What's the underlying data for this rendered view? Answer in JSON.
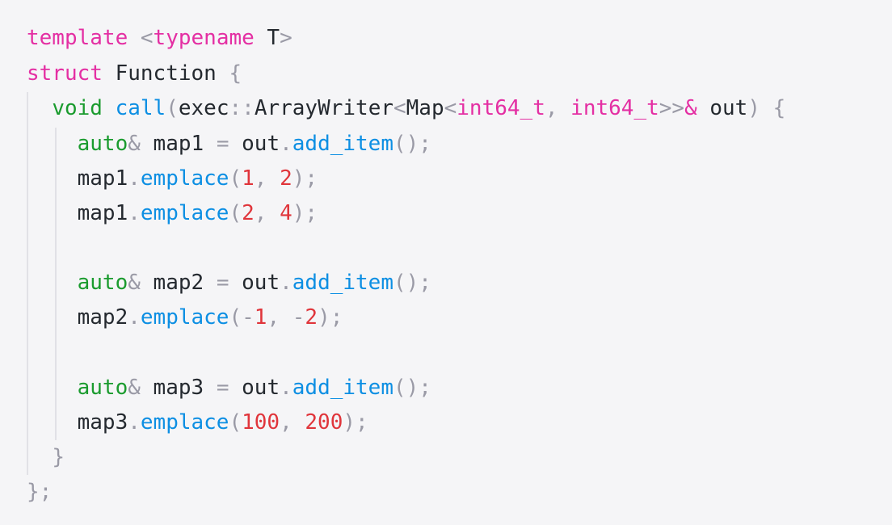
{
  "colors": {
    "background": "#f5f5f7",
    "plain": "#24292f",
    "keyword_pink": "#e42fa3",
    "keyword_green": "#1a9b2e",
    "function_blue": "#0d8fe3",
    "number_red": "#e0353b",
    "punctuation_gray": "#9a9aa6",
    "indent_guide": "#e1e1e6"
  },
  "code": {
    "lines": [
      {
        "tokens": [
          {
            "text": "template",
            "color": "#e42fa3"
          },
          {
            "text": " ",
            "color": "#24292f"
          },
          {
            "text": "<",
            "color": "#9a9aa6"
          },
          {
            "text": "typename",
            "color": "#e42fa3"
          },
          {
            "text": " T",
            "color": "#24292f"
          },
          {
            "text": ">",
            "color": "#9a9aa6"
          }
        ]
      },
      {
        "tokens": [
          {
            "text": "struct",
            "color": "#e42fa3"
          },
          {
            "text": " Function ",
            "color": "#24292f"
          },
          {
            "text": "{",
            "color": "#9a9aa6"
          }
        ]
      },
      {
        "tokens": [
          {
            "text": "  ",
            "color": "#24292f"
          },
          {
            "text": "void",
            "color": "#1a9b2e"
          },
          {
            "text": " ",
            "color": "#24292f"
          },
          {
            "text": "call",
            "color": "#0d8fe3"
          },
          {
            "text": "(",
            "color": "#9a9aa6"
          },
          {
            "text": "exec",
            "color": "#24292f"
          },
          {
            "text": "::",
            "color": "#9a9aa6"
          },
          {
            "text": "ArrayWriter",
            "color": "#24292f"
          },
          {
            "text": "<",
            "color": "#9a9aa6"
          },
          {
            "text": "Map",
            "color": "#24292f"
          },
          {
            "text": "<",
            "color": "#9a9aa6"
          },
          {
            "text": "int64_t",
            "color": "#e42fa3"
          },
          {
            "text": ", ",
            "color": "#9a9aa6"
          },
          {
            "text": "int64_t",
            "color": "#e42fa3"
          },
          {
            "text": ">>",
            "color": "#9a9aa6"
          },
          {
            "text": "&",
            "color": "#e42fa3"
          },
          {
            "text": " out",
            "color": "#24292f"
          },
          {
            "text": ") {",
            "color": "#9a9aa6"
          }
        ]
      },
      {
        "tokens": [
          {
            "text": "    ",
            "color": "#24292f"
          },
          {
            "text": "auto",
            "color": "#1a9b2e"
          },
          {
            "text": "&",
            "color": "#9a9aa6"
          },
          {
            "text": " map1 ",
            "color": "#24292f"
          },
          {
            "text": "=",
            "color": "#9a9aa6"
          },
          {
            "text": " out",
            "color": "#24292f"
          },
          {
            "text": ".",
            "color": "#9a9aa6"
          },
          {
            "text": "add_item",
            "color": "#0d8fe3"
          },
          {
            "text": "();",
            "color": "#9a9aa6"
          }
        ]
      },
      {
        "tokens": [
          {
            "text": "    map1",
            "color": "#24292f"
          },
          {
            "text": ".",
            "color": "#9a9aa6"
          },
          {
            "text": "emplace",
            "color": "#0d8fe3"
          },
          {
            "text": "(",
            "color": "#9a9aa6"
          },
          {
            "text": "1",
            "color": "#e0353b"
          },
          {
            "text": ", ",
            "color": "#9a9aa6"
          },
          {
            "text": "2",
            "color": "#e0353b"
          },
          {
            "text": ");",
            "color": "#9a9aa6"
          }
        ]
      },
      {
        "tokens": [
          {
            "text": "    map1",
            "color": "#24292f"
          },
          {
            "text": ".",
            "color": "#9a9aa6"
          },
          {
            "text": "emplace",
            "color": "#0d8fe3"
          },
          {
            "text": "(",
            "color": "#9a9aa6"
          },
          {
            "text": "2",
            "color": "#e0353b"
          },
          {
            "text": ", ",
            "color": "#9a9aa6"
          },
          {
            "text": "4",
            "color": "#e0353b"
          },
          {
            "text": ");",
            "color": "#9a9aa6"
          }
        ]
      },
      {
        "tokens": []
      },
      {
        "tokens": [
          {
            "text": "    ",
            "color": "#24292f"
          },
          {
            "text": "auto",
            "color": "#1a9b2e"
          },
          {
            "text": "&",
            "color": "#9a9aa6"
          },
          {
            "text": " map2 ",
            "color": "#24292f"
          },
          {
            "text": "=",
            "color": "#9a9aa6"
          },
          {
            "text": " out",
            "color": "#24292f"
          },
          {
            "text": ".",
            "color": "#9a9aa6"
          },
          {
            "text": "add_item",
            "color": "#0d8fe3"
          },
          {
            "text": "();",
            "color": "#9a9aa6"
          }
        ]
      },
      {
        "tokens": [
          {
            "text": "    map2",
            "color": "#24292f"
          },
          {
            "text": ".",
            "color": "#9a9aa6"
          },
          {
            "text": "emplace",
            "color": "#0d8fe3"
          },
          {
            "text": "(",
            "color": "#9a9aa6"
          },
          {
            "text": "-",
            "color": "#9a9aa6"
          },
          {
            "text": "1",
            "color": "#e0353b"
          },
          {
            "text": ", ",
            "color": "#9a9aa6"
          },
          {
            "text": "-",
            "color": "#9a9aa6"
          },
          {
            "text": "2",
            "color": "#e0353b"
          },
          {
            "text": ");",
            "color": "#9a9aa6"
          }
        ]
      },
      {
        "tokens": []
      },
      {
        "tokens": [
          {
            "text": "    ",
            "color": "#24292f"
          },
          {
            "text": "auto",
            "color": "#1a9b2e"
          },
          {
            "text": "&",
            "color": "#9a9aa6"
          },
          {
            "text": " map3 ",
            "color": "#24292f"
          },
          {
            "text": "=",
            "color": "#9a9aa6"
          },
          {
            "text": " out",
            "color": "#24292f"
          },
          {
            "text": ".",
            "color": "#9a9aa6"
          },
          {
            "text": "add_item",
            "color": "#0d8fe3"
          },
          {
            "text": "();",
            "color": "#9a9aa6"
          }
        ]
      },
      {
        "tokens": [
          {
            "text": "    map3",
            "color": "#24292f"
          },
          {
            "text": ".",
            "color": "#9a9aa6"
          },
          {
            "text": "emplace",
            "color": "#0d8fe3"
          },
          {
            "text": "(",
            "color": "#9a9aa6"
          },
          {
            "text": "100",
            "color": "#e0353b"
          },
          {
            "text": ", ",
            "color": "#9a9aa6"
          },
          {
            "text": "200",
            "color": "#e0353b"
          },
          {
            "text": ");",
            "color": "#9a9aa6"
          }
        ]
      },
      {
        "tokens": [
          {
            "text": "  ",
            "color": "#24292f"
          },
          {
            "text": "}",
            "color": "#9a9aa6"
          }
        ]
      },
      {
        "tokens": [
          {
            "text": "};",
            "color": "#9a9aa6"
          }
        ]
      }
    ]
  }
}
